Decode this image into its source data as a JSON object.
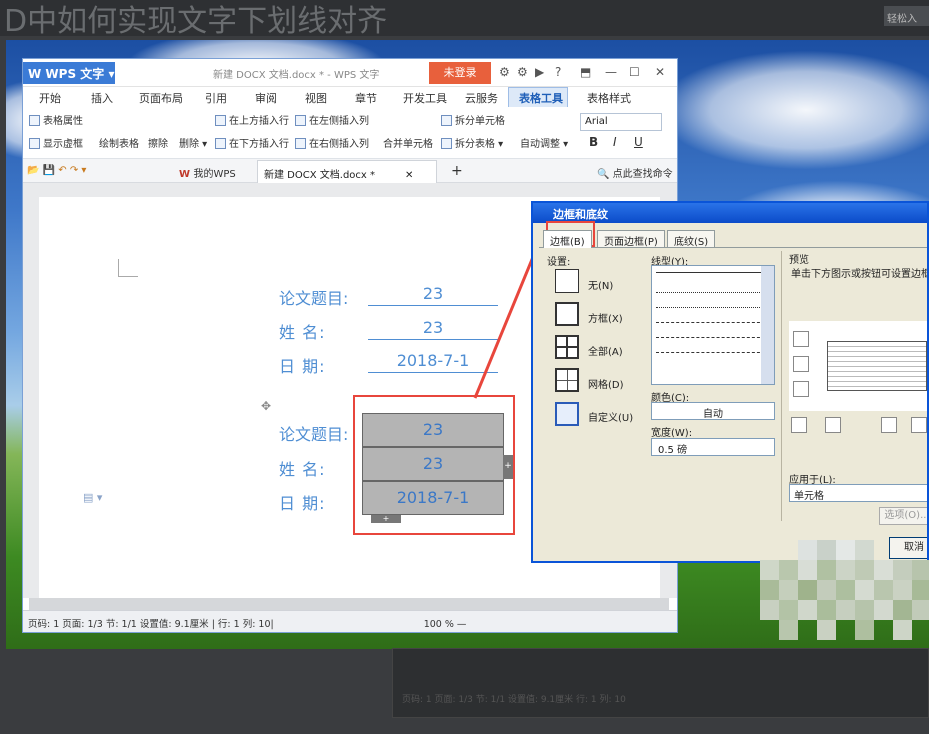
{
  "background": {
    "top_title": "D中如何实现文字下划线对齐",
    "top_button": "轻松入",
    "bottom_status": "页码: 1 页面: 1/3 节: 1/1 设置值: 9.1厘米 行: 1 列: 10"
  },
  "wps": {
    "logo": "W WPS 文字 ▾",
    "title": "新建 DOCX 文档.docx * - WPS 文字",
    "login_button": "未登录",
    "menu": [
      "开始",
      "插入",
      "页面布局",
      "引用",
      "审阅",
      "视图",
      "章节",
      "开发工具",
      "云服务",
      "表格工具",
      "表格样式"
    ],
    "ribbon": {
      "table_props": "表格属性",
      "show_grid": "显示虚框",
      "draw_table": "绘制表格",
      "erase": "擦除",
      "delete": "删除 ▾",
      "insert_above": "在上方插入行",
      "insert_below": "在下方插入行",
      "insert_left": "在左侧插入列",
      "insert_right": "在右侧插入列",
      "merge_cells": "合并单元格",
      "split_cells": "拆分单元格",
      "split_table": "拆分表格 ▾",
      "auto_fit": "自动调整 ▾",
      "font_name": "Arial",
      "bold": "B",
      "italic": "I",
      "underline": "U"
    },
    "tabs": {
      "my_wps": "我的WPS",
      "doc_tab": "新建 DOCX 文档.docx *",
      "search": "点此查找命令"
    },
    "doc": {
      "rows_top": [
        {
          "label": "论文题目:",
          "value": "23"
        },
        {
          "label": "姓    名:",
          "value": "23"
        },
        {
          "label": "日    期:",
          "value": "2018-7-1"
        }
      ],
      "rows_table": [
        {
          "label": "论文题目:",
          "value": "23"
        },
        {
          "label": "姓    名:",
          "value": "23"
        },
        {
          "label": "日    期:",
          "value": "2018-7-1"
        }
      ]
    },
    "status": "页码: 1  页面: 1/3  节: 1/1  设置值: 9.1厘米 | 行: 1  列: 10|",
    "zoom": "100 % —"
  },
  "dialog": {
    "title": "边框和底纹",
    "tabs": [
      "边框(B)",
      "页面边框(P)",
      "底纹(S)"
    ],
    "setting_label": "设置:",
    "settings": [
      "无(N)",
      "方框(X)",
      "全部(A)",
      "网格(D)",
      "自定义(U)"
    ],
    "style_label": "线型(Y):",
    "color_label": "颜色(C):",
    "color_value": "自动",
    "width_label": "宽度(W):",
    "width_value": "0.5 磅",
    "preview_label": "预览",
    "preview_hint": "单击下方图示或按钮可设置边框",
    "apply_label": "应用于(L):",
    "apply_value": "单元格",
    "options_button": "选项(O)...",
    "cancel_button": "取消"
  }
}
